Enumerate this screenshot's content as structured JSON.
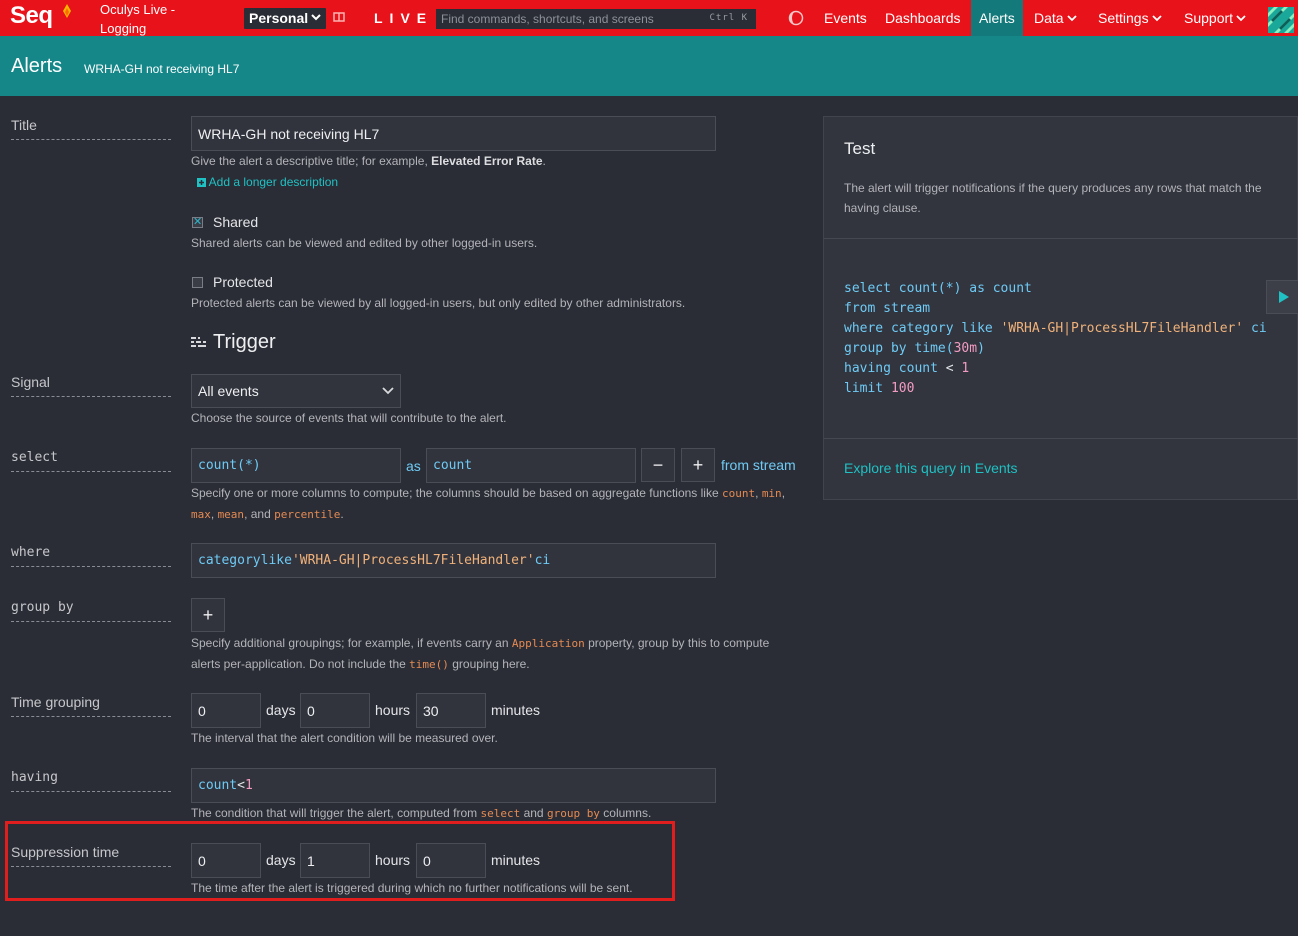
{
  "nav": {
    "logo": "Seq",
    "instance": "Oculys Live - Logging",
    "workspace": "Personal",
    "live": "LIVE",
    "command_placeholder": "Find commands, shortcuts, and screens",
    "command_shortcut": "Ctrl K",
    "items": [
      {
        "label": "Events"
      },
      {
        "label": "Dashboards"
      },
      {
        "label": "Alerts",
        "active": true
      },
      {
        "label": "Data",
        "dropdown": true
      },
      {
        "label": "Settings",
        "dropdown": true
      },
      {
        "label": "Support",
        "dropdown": true
      }
    ],
    "accent": "#e8121a",
    "active_color": "#14797a"
  },
  "header": {
    "section": "Alerts",
    "alert_name": "WRHA-GH not receiving HL7"
  },
  "form": {
    "title_label": "Title",
    "title_value": "WRHA-GH not receiving HL7",
    "title_hint_prefix": "Give the alert a descriptive title; for example,",
    "title_hint_example": "Elevated Error Rate",
    "title_hint_suffix": ".",
    "add_description": "Add a longer description",
    "shared_label": "Shared",
    "shared_checked": true,
    "shared_hint": "Shared alerts can be viewed and edited by other logged-in users.",
    "protected_label": "Protected",
    "protected_checked": false,
    "protected_hint": "Protected alerts can be viewed by all logged-in users, but only edited by other administrators.",
    "trigger_heading": "Trigger",
    "signal_label": "Signal",
    "signal_value": "All events",
    "signal_hint": "Choose the source of events that will contribute to the alert.",
    "select_label": "select",
    "select_expr": "count(*)",
    "as_text": "as",
    "select_alias": "count",
    "minus": "−",
    "plus": "+",
    "from_stream": "from stream",
    "select_hint_1": "Specify one or more columns to compute; the columns should be based on aggregate functions like",
    "agg_count": "count",
    "agg_min": "min",
    "agg_max": "max",
    "agg_mean": "mean",
    "agg_and": ", and",
    "agg_percentile": "percentile",
    "comma": ",",
    "period": ".",
    "where_label": "where",
    "where_field": "category",
    "where_op": "like",
    "where_value": "'WRHA-GH|ProcessHL7FileHandler'",
    "where_ci": "ci",
    "groupby_label": "group by",
    "groupby_hint_1": "Specify additional groupings; for example, if events carry an",
    "groupby_example": "Application",
    "groupby_hint_2": "property, group by this to compute",
    "groupby_hint_3": "alerts per-application. Do not include the",
    "groupby_time": "time()",
    "groupby_hint_4": "grouping here.",
    "time_grouping_label": "Time grouping",
    "time_grouping": {
      "days": "0",
      "hours": "0",
      "minutes": "30"
    },
    "unit_days": "days",
    "unit_hours": "hours",
    "unit_minutes": "minutes",
    "time_grouping_hint": "The interval that the alert condition will be measured over.",
    "having_label": "having",
    "having_field": "count",
    "having_op": "<",
    "having_value": "1",
    "having_hint_1": "The condition that will trigger the alert, computed from",
    "having_select": "select",
    "having_and": "and",
    "having_groupby": "group by",
    "having_hint_2": "columns.",
    "suppression_label": "Suppression time",
    "suppression": {
      "days": "0",
      "hours": "1",
      "minutes": "0"
    },
    "suppression_hint": "The time after the alert is triggered during which no further notifications will be sent."
  },
  "test_panel": {
    "title": "Test",
    "description": "The alert will trigger notifications if the query produces any rows that match the having clause.",
    "query": {
      "l1_kw": "select",
      "l1_fn": "count(*)",
      "l1_as": "as",
      "l1_alias": "count",
      "l2_kw": "from",
      "l2_src": "stream",
      "l3_kw": "where",
      "l3_field": "category",
      "l3_op": "like",
      "l3_str": "'WRHA-GH|ProcessHL7FileHandler'",
      "l3_ci": "ci",
      "l4_kw": "group by",
      "l4_fn": "time(",
      "l4_num": "30m",
      "l4_close": ")",
      "l5_kw": "having",
      "l5_field": "count",
      "l5_op": "<",
      "l5_num": "1",
      "l6_kw": "limit",
      "l6_num": "100"
    },
    "explore_link": "Explore this query in Events"
  }
}
